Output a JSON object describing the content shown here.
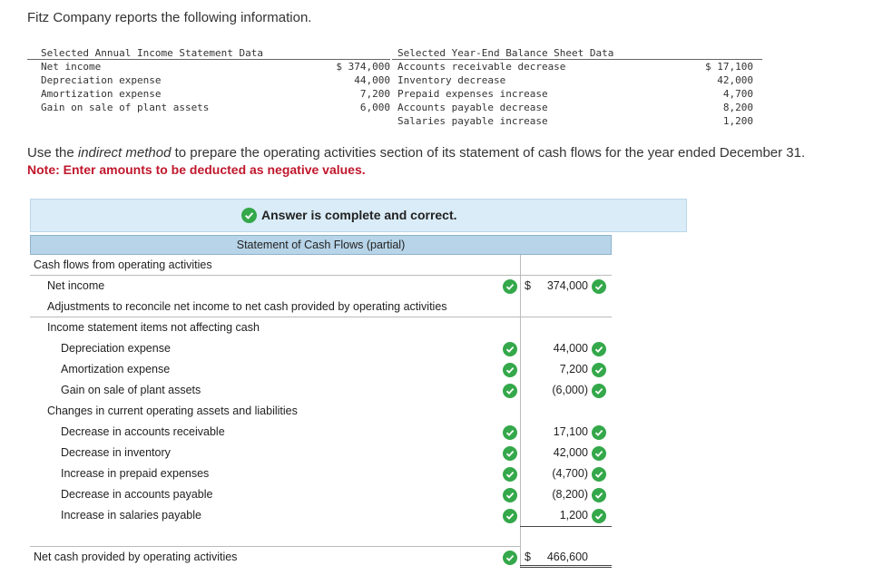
{
  "intro": "Fitz Company reports the following information.",
  "given": {
    "income_header": "Selected Annual Income Statement Data",
    "balance_header": "Selected Year-End Balance Sheet Data",
    "income_rows": [
      {
        "label": "Net income",
        "value": "$ 374,000"
      },
      {
        "label": "Depreciation expense",
        "value": "44,000"
      },
      {
        "label": "Amortization expense",
        "value": "7,200"
      },
      {
        "label": "Gain on sale of plant assets",
        "value": "6,000"
      }
    ],
    "balance_rows": [
      {
        "label": "Accounts receivable decrease",
        "value": "$ 17,100"
      },
      {
        "label": "Inventory decrease",
        "value": "42,000"
      },
      {
        "label": "Prepaid expenses increase",
        "value": "4,700"
      },
      {
        "label": "Accounts payable decrease",
        "value": "8,200"
      },
      {
        "label": "Salaries payable increase",
        "value": "1,200"
      }
    ]
  },
  "instruction": {
    "pre": "Use the ",
    "em": "indirect method",
    "post": " to prepare the operating activities section of its statement of cash flows for the year ended December 31."
  },
  "note": "Note: Enter amounts to be deducted as negative values.",
  "banner": "Answer is complete and correct.",
  "table": {
    "title": "Statement of Cash Flows (partial)",
    "section": "Cash flows from operating activities",
    "net_income_label": "Net income",
    "net_income_currency": "$",
    "net_income_value": "374,000",
    "adjustments_label": "Adjustments to reconcile net income to net cash provided by operating activities",
    "noncash_label": "Income statement items not affecting cash",
    "noncash_rows": [
      {
        "label": "Depreciation expense",
        "value": "44,000"
      },
      {
        "label": "Amortization expense",
        "value": "7,200"
      },
      {
        "label": "Gain on sale of plant assets",
        "value": "(6,000)"
      }
    ],
    "changes_label": "Changes in current operating assets and liabilities",
    "changes_rows": [
      {
        "label": "Decrease in accounts receivable",
        "value": "17,100"
      },
      {
        "label": "Decrease in inventory",
        "value": "42,000"
      },
      {
        "label": "Increase in prepaid expenses",
        "value": "(4,700)"
      },
      {
        "label": "Decrease in accounts payable",
        "value": "(8,200)"
      },
      {
        "label": "Increase in salaries payable",
        "value": "1,200"
      }
    ],
    "total_label": "Net cash provided by operating activities",
    "total_currency": "$",
    "total_value": "466,600"
  },
  "colors": {
    "check": "#34a84a",
    "note": "#c0172c",
    "banner": "#d9ecf7",
    "header": "#b7d4e8"
  }
}
